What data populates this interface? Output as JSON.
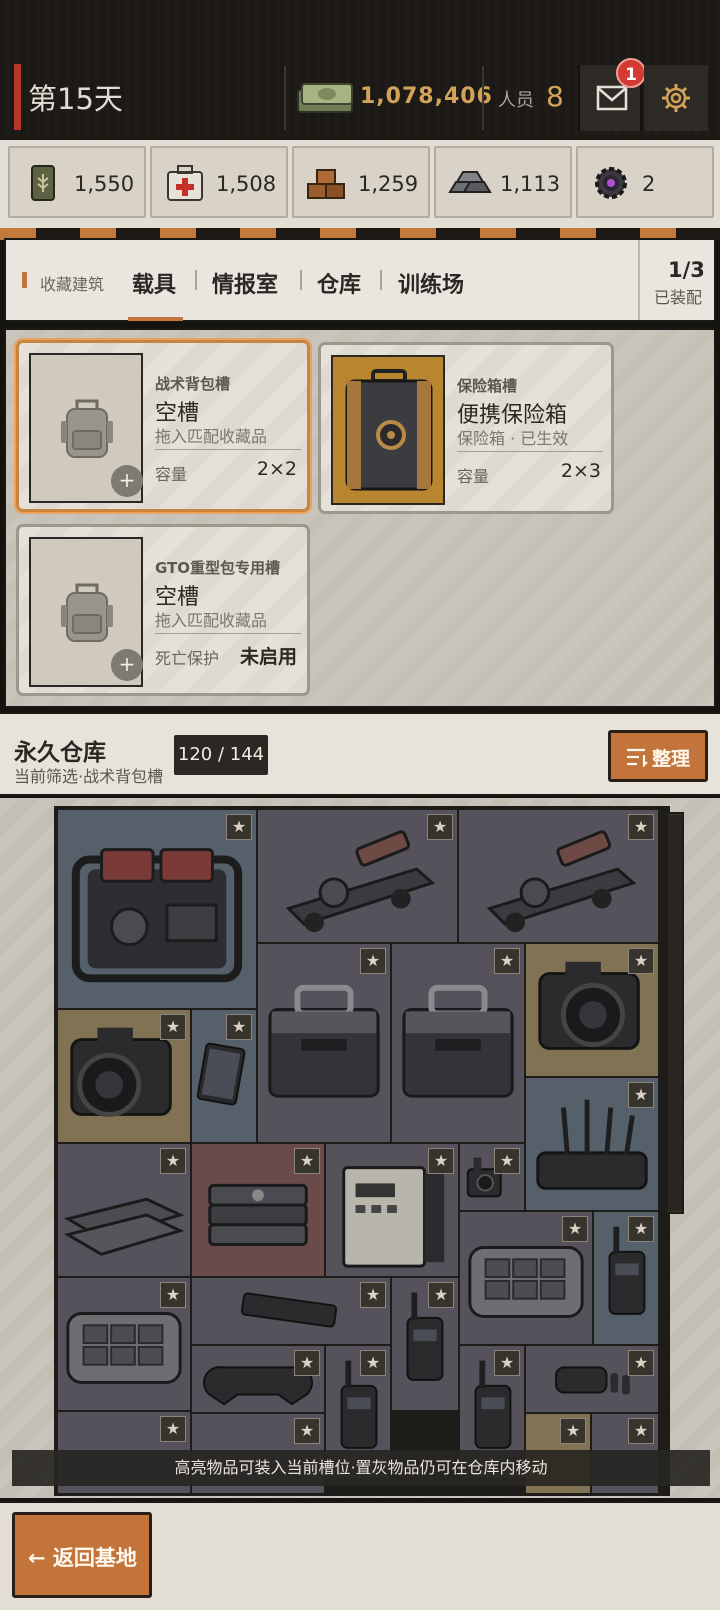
{
  "header": {
    "day": "第15天",
    "cash": "1,078,406",
    "crew_label": "人员",
    "crew_count": "8",
    "mail_badge": "1",
    "icons": [
      "cash-icon",
      "mail-icon",
      "settings-icon"
    ]
  },
  "resources": [
    {
      "icon": "supply-can-icon",
      "value": "1,550"
    },
    {
      "icon": "medkit-icon",
      "value": "1,508"
    },
    {
      "icon": "wood-icon",
      "value": "1,259"
    },
    {
      "icon": "metal-ingot-icon",
      "value": "1,113"
    },
    {
      "icon": "gear-part-icon",
      "value": "2"
    }
  ],
  "tabs": {
    "favorite_label": "收藏建筑",
    "items": [
      "载具",
      "情报室",
      "仓库",
      "训练场"
    ],
    "active": "载具",
    "equipped_count": "1/3",
    "equipped_label": "已装配"
  },
  "slots": [
    {
      "type": "战术背包槽",
      "name": "空槽",
      "hint": "拖入匹配收藏品",
      "key": "容量",
      "value": "2×2",
      "active": true
    },
    {
      "type": "保险箱槽",
      "name": "便携保险箱",
      "hint": "保险箱 · 已生效",
      "key": "容量",
      "value": "2×3",
      "active": false
    },
    {
      "type": "GTO重型包专用槽",
      "name": "空槽",
      "hint": "拖入匹配收藏品",
      "key": "死亡保护",
      "value": "未启用",
      "active": false
    }
  ],
  "storage": {
    "title": "永久仓库",
    "filter": "当前筛选·战术背包槽",
    "count": "120 / 144",
    "sort_label": "整理"
  },
  "items": [
    "generator",
    "floor-jack",
    "floor-jack",
    "battery",
    "battery",
    "camera",
    "camera",
    "tablet",
    "router",
    "metal-plates",
    "ammo-stack",
    "control-panel",
    "dashcam",
    "tackle-box",
    "walkie-talkie",
    "tackle-box",
    "scanner",
    "walkie-talkie",
    "gamepad",
    "walkie-talkie",
    "walkie-talkie",
    "earbuds-case"
  ],
  "tip": "高亮物品可装入当前槽位·置灰物品仍可在仓库内移动",
  "back_label": "返回基地"
}
